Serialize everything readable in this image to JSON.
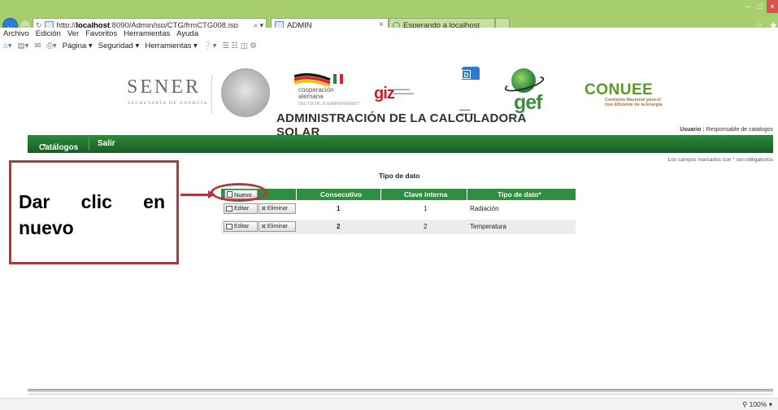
{
  "browser": {
    "address": {
      "prefix": "http://",
      "host": "localhost",
      "path": ":8090/Admin/jsp/CTG/frmCTG008.jsp",
      "controls": "⌕ ▾"
    },
    "tabs": [
      {
        "label": "ADMIN",
        "close": "×"
      },
      {
        "label": "Esperando a localhost"
      }
    ],
    "menu": [
      "Archivo",
      "Edición",
      "Ver",
      "Favoritos",
      "Herramientas",
      "Ayuda"
    ],
    "commands": [
      "Página ▾",
      "Seguridad ▾",
      "Herramientas ▾"
    ],
    "zoom": "100%"
  },
  "header": {
    "sener": "SENER",
    "sener_sub": "SECRETARÍA DE ENERGÍA",
    "coop": [
      "cooperación",
      "alemana"
    ],
    "coop_sub": "DEUTSCHE ZUSAMMENARBEIT",
    "giz": "giz",
    "undp": [
      "P",
      "N",
      "U",
      "D"
    ],
    "gef": "gef",
    "conuee": "CONUEE",
    "conuee_sub": [
      "Comisión Nacional para el",
      "Uso Eficiente de la Energía"
    ],
    "title": "ADMINISTRACIÓN DE LA CALCULADORA SOLAR",
    "user_label": "Usuario :",
    "user_value": "Responsable de catalogos"
  },
  "nav": {
    "catalogos": "Catálogos",
    "salir": "Salir"
  },
  "required_note": "Los campos marcados con * son obligatorios",
  "section_title": "Tipo de dato",
  "table": {
    "new_button": "Nuevo",
    "columns": [
      "Consecutivo",
      "Clave interna",
      "Tipo de dato*"
    ],
    "edit_label": "Editar",
    "delete_label": "Eliminar",
    "rows": [
      {
        "consecutivo": "1",
        "clave": "1",
        "tipo": "Radiación"
      },
      {
        "consecutivo": "2",
        "clave": "2",
        "tipo": "Temperatura"
      }
    ]
  },
  "annotation": {
    "line1": "Dar clic en",
    "line2": "nuevo",
    "color": "#b0393f"
  },
  "colors": {
    "chrome": "#a8cf6e",
    "nav_green": "#2f8e3f"
  }
}
